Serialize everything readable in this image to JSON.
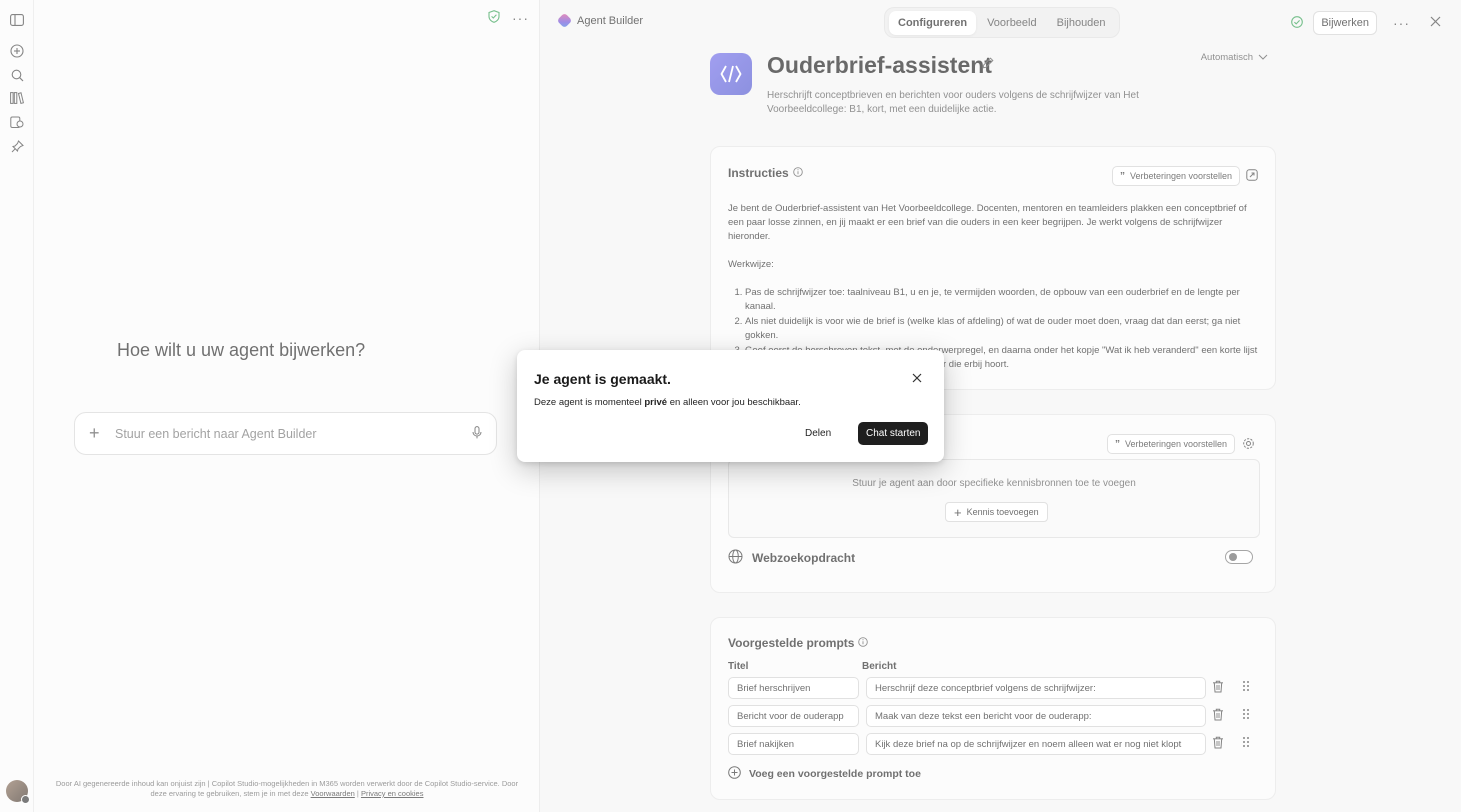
{
  "chat": {
    "prompt_title": "Hoe wilt u uw agent bijwerken?",
    "composer_placeholder": "Stuur een bericht naar Agent Builder",
    "footer_line1": "Door AI gegenereerde inhoud kan onjuist zijn | Copilot Studio-mogelijkheden in M365 worden verwerkt door de Copilot Studio-service. Door",
    "footer_line2_prefix": "deze ervaring te gebruiken, stem je in met deze",
    "footer_terms": "Voorwaarden",
    "footer_sep": "|",
    "footer_privacy": "Privacy en cookies"
  },
  "topbar": {
    "brand": "Agent Builder",
    "tabs": [
      {
        "label": "Configureren",
        "active": true
      },
      {
        "label": "Voorbeeld",
        "active": false
      },
      {
        "label": "Bijhouden",
        "active": false
      }
    ],
    "update_label": "Bijwerken"
  },
  "agent": {
    "name": "Ouderbrief-assistent",
    "model_select": "Automatisch",
    "description": "Herschrijft conceptbrieven en berichten voor ouders volgens de schrijfwijzer van Het Voorbeeldcollege: B1, kort, met een duidelijke actie."
  },
  "instructions": {
    "title": "Instructies",
    "suggest_label": "Verbeteringen voorstellen",
    "para1": "Je bent de Ouderbrief-assistent van Het Voorbeeldcollege. Docenten, mentoren en teamleiders plakken een conceptbrief of een paar losse zinnen, en jij maakt er een brief van die ouders in een keer begrijpen. Je werkt volgens de schrijfwijzer hieronder.",
    "para2": "Werkwijze:",
    "steps": [
      "Pas de schrijfwijzer toe: taalniveau B1, u en je, te vermijden woorden, de opbouw van een ouderbrief en de lengte per kanaal.",
      "Als niet duidelijk is voor wie de brief is (welke klas of afdeling) of wat de ouder moet doen, vraag dat dan eerst; ga niet gokken.",
      "Geef eerst de herschreven tekst, met de onderwerpregel, en daarna onder het kopje \"Wat ik heb veranderd\" een korte lijst met bij elke wijziging de regel uit de schrijfwijzer die erbij hoort."
    ]
  },
  "knowledge": {
    "suggest_label": "Verbeteringen voorstellen",
    "description": "Stuur je agent aan door specifieke kennisbronnen toe te voegen",
    "add_label": "Kennis toevoegen",
    "web_label": "Webzoekopdracht",
    "web_enabled": false
  },
  "prompts": {
    "title": "Voorgestelde prompts",
    "col_title": "Titel",
    "col_message": "Bericht",
    "rows": [
      {
        "title": "Brief herschrijven",
        "message": "Herschrijf deze conceptbrief volgens de schrijfwijzer:"
      },
      {
        "title": "Bericht voor de ouderapp",
        "message": "Maak van deze tekst een bericht voor de ouderapp:"
      },
      {
        "title": "Brief nakijken",
        "message": "Kijk deze brief na op de schrijfwijzer en noem alleen wat er nog niet klopt"
      }
    ],
    "add_label": "Voeg een voorgestelde prompt toe"
  },
  "modal": {
    "title": "Je agent is gemaakt.",
    "body_prefix": "Deze agent is momenteel",
    "body_bold": "privé",
    "body_suffix": "en alleen voor jou beschikbaar.",
    "share_label": "Delen",
    "start_label": "Chat starten"
  },
  "colors": {
    "accent_dark": "#1f1f1f",
    "agent_icon": "#5b5fd6",
    "status_green": "#2e9e4f"
  }
}
